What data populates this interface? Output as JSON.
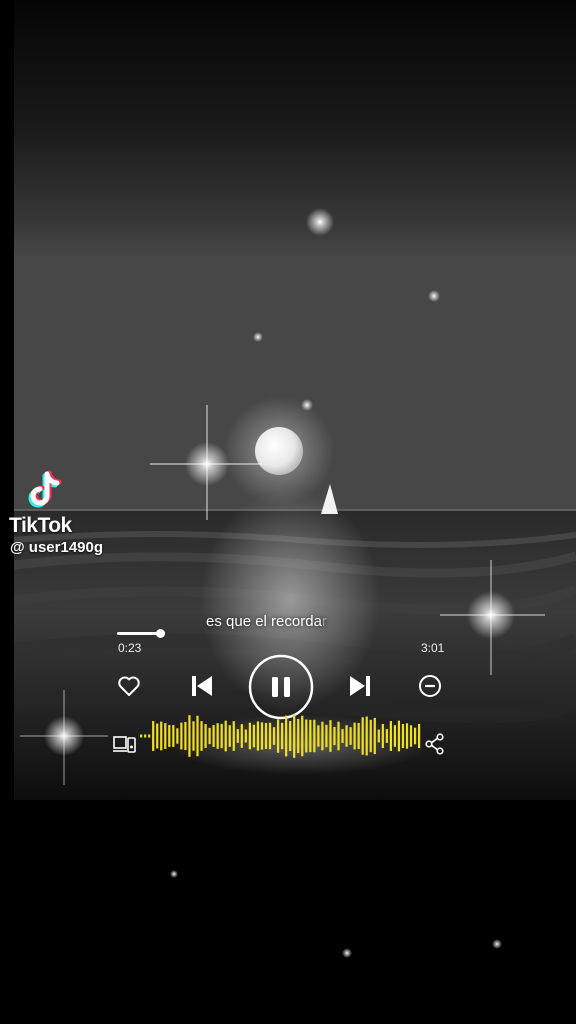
{
  "brand": {
    "name": "TikTok",
    "user": "@ user1490g"
  },
  "player": {
    "lyric_main": "es que el recorda",
    "lyric_fade": "r",
    "current_time": "0:23",
    "total_time": "3:01",
    "progress": 0.127,
    "state": "playing"
  },
  "icons": {
    "like": "heart-icon",
    "previous": "skip-previous-icon",
    "pause": "pause-icon",
    "next": "skip-next-icon",
    "remove": "minus-circle-icon",
    "devices": "devices-icon",
    "share": "share-icon"
  },
  "colors": {
    "waveform": "#f2e01c",
    "text": "#ffffff",
    "background": "#000000"
  }
}
